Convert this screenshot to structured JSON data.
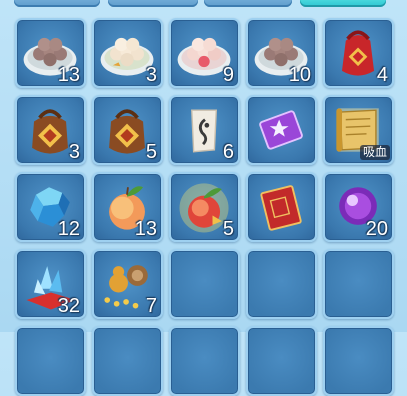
{
  "inventory": {
    "slots": [
      {
        "name": "dumpling-plate-brown",
        "count": "13"
      },
      {
        "name": "dumpling-plate-white",
        "count": "3"
      },
      {
        "name": "dumpling-plate-pink",
        "count": "9"
      },
      {
        "name": "dumpling-plate-brown",
        "count": "10"
      },
      {
        "name": "red-lucky-bag",
        "count": "4"
      },
      {
        "name": "brown-lucky-bag",
        "count": "3"
      },
      {
        "name": "brown-lucky-bag",
        "count": "5"
      },
      {
        "name": "swirl-scroll",
        "count": "6"
      },
      {
        "name": "purple-star-ticket",
        "count": ""
      },
      {
        "name": "golden-scroll",
        "count": "",
        "tag": "吸血"
      },
      {
        "name": "blue-crystal",
        "count": "12"
      },
      {
        "name": "peach",
        "count": "13"
      },
      {
        "name": "magic-peach",
        "count": "5"
      },
      {
        "name": "red-envelope-book",
        "count": ""
      },
      {
        "name": "purple-orb",
        "count": "20"
      },
      {
        "name": "crystal-cushion",
        "count": "32"
      },
      {
        "name": "gourd-coins",
        "count": "7"
      },
      {
        "name": "empty",
        "count": ""
      },
      {
        "name": "empty",
        "count": ""
      },
      {
        "name": "empty",
        "count": ""
      }
    ]
  }
}
